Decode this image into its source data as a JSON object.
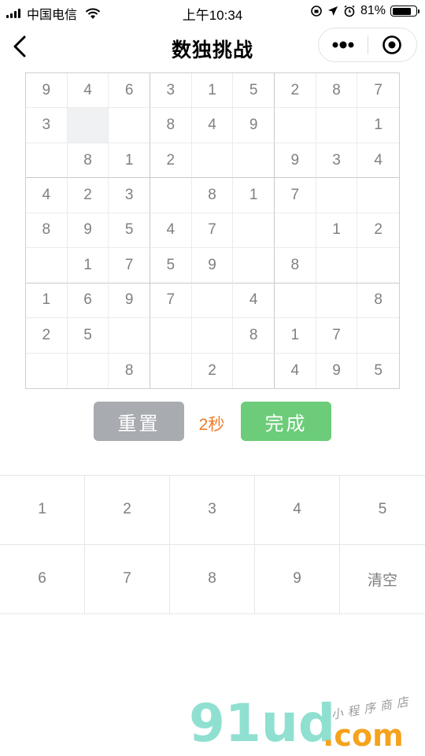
{
  "status_bar": {
    "carrier": "中国电信",
    "time": "上午10:34",
    "battery": "81%",
    "battery_level": 0.81
  },
  "nav": {
    "title": "数独挑战",
    "icons": {
      "back": "chevron-left-icon",
      "more": "more-dots-icon",
      "close": "target-icon"
    }
  },
  "board": {
    "rows": [
      [
        "9",
        "4",
        "6",
        "3",
        "1",
        "5",
        "2",
        "8",
        "7"
      ],
      [
        "3",
        "",
        "",
        "8",
        "4",
        "9",
        "",
        "",
        "1"
      ],
      [
        "",
        "8",
        "1",
        "2",
        "",
        "",
        "9",
        "3",
        "4"
      ],
      [
        "4",
        "2",
        "3",
        "",
        "8",
        "1",
        "7",
        "",
        ""
      ],
      [
        "8",
        "9",
        "5",
        "4",
        "7",
        "",
        "",
        "1",
        "2"
      ],
      [
        "",
        "1",
        "7",
        "5",
        "9",
        "",
        "8",
        "",
        ""
      ],
      [
        "1",
        "6",
        "9",
        "7",
        "",
        "4",
        "",
        "",
        "8"
      ],
      [
        "2",
        "5",
        "",
        "",
        "",
        "8",
        "1",
        "7",
        ""
      ],
      [
        "",
        "",
        "8",
        "",
        "2",
        "",
        "4",
        "9",
        "5"
      ]
    ],
    "selected": [
      1,
      1
    ]
  },
  "controls": {
    "reset_label": "重置",
    "timer": "2秒",
    "done_label": "完成"
  },
  "keypad": {
    "keys": [
      "1",
      "2",
      "3",
      "4",
      "5",
      "6",
      "7",
      "8",
      "9",
      "清空"
    ]
  },
  "watermark": {
    "logo": "91ud",
    "domain": ".com",
    "tagline": "小程序商店"
  },
  "colors": {
    "accent_green": "#6ccc79",
    "reset_gray": "#a8abb0",
    "timer_orange": "#ef7b2c"
  }
}
